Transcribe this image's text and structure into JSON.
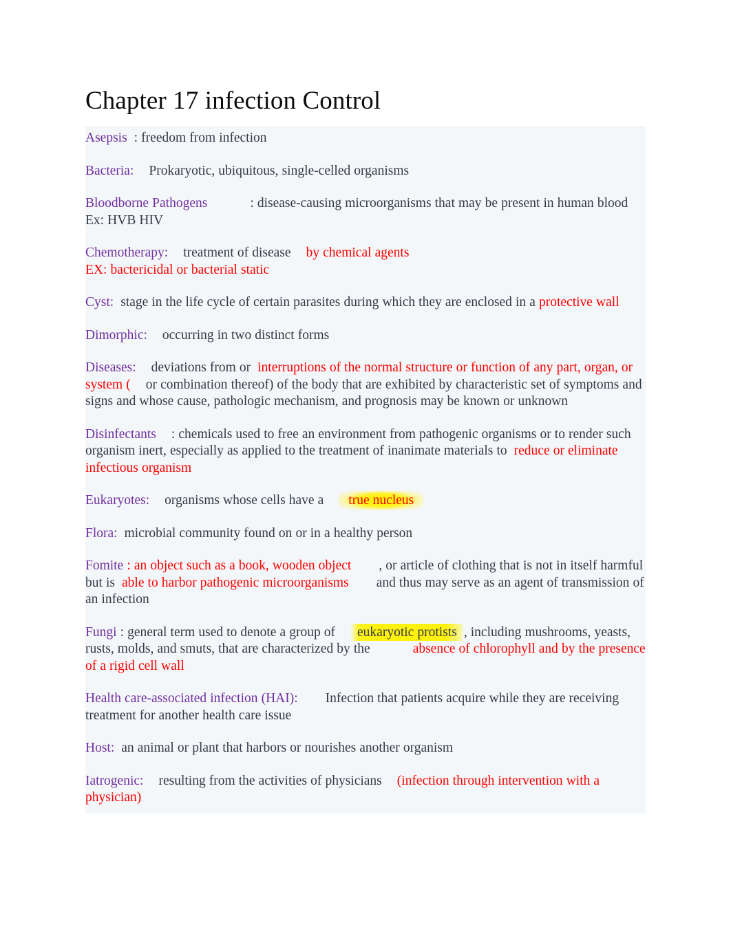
{
  "document": {
    "title": "Chapter 17 infection Control",
    "colors": {
      "term": "#7030A0",
      "accent_red": "#FF0000",
      "body_text": "#333A45",
      "highlight_yellow": "#FFF200",
      "content_background": "#F4F7F9",
      "page_background": "#FFFFFF"
    }
  },
  "entries": {
    "asepsis": {
      "term": "Asepsis",
      "sep": ": ",
      "definition": "freedom from infection"
    },
    "bacteria": {
      "term": "Bacteria:",
      "definition": "Prokaryotic, ubiquitous, single-celled organisms"
    },
    "bloodborne": {
      "term": "Bloodborne Pathogens",
      "sep": ":  ",
      "definition": "disease-causing microorganisms that may be present in human blood",
      "example": "Ex: HVB HIV"
    },
    "chemotherapy": {
      "term": "Chemotherapy:",
      "definition": "treatment of disease",
      "red_part": "by chemical agents",
      "example_red": "EX: bactericidal or bacterial static"
    },
    "cyst": {
      "term": "Cyst:",
      "definition": "stage in the life cycle of certain parasites during which they are enclosed in a",
      "red_part": "protective wall"
    },
    "dimorphic": {
      "term": "Dimorphic:",
      "definition": "occurring in two distinct forms"
    },
    "diseases": {
      "term": "Diseases:",
      "definition_a": "deviations from or",
      "red_part_a": "interruptions of the normal structure or function of any part, organ, or system (",
      "definition_b": "or combination thereof) of the body that are exhibited by characteristic set of symptoms and signs and whose cause, pathologic mechanism, and prognosis may be known or unknown"
    },
    "disinfectants": {
      "term": "Disinfectants",
      "sep": ": ",
      "definition": "chemicals used to free an environment from pathogenic organisms or to render such organism inert, especially as applied to the treatment of inanimate materials to",
      "red_part": "reduce or eliminate infectious organism"
    },
    "eukaryotes": {
      "term": "Eukaryotes:",
      "definition": "organisms whose cells have a",
      "highlighted_red": "true nucleus"
    },
    "flora": {
      "term": "Flora:",
      "definition": "microbial community found on or in a healthy person"
    },
    "fomite": {
      "term": "Fomite",
      "sep": " : ",
      "red_part_a": "an object such as a book, wooden object",
      "definition_a": ", or article of clothing that is not in itself harmful but is",
      "red_part_b": "able to harbor pathogenic microorganisms",
      "definition_b": "and thus may serve as an agent of transmission of an infection"
    },
    "fungi": {
      "term": "Fungi",
      "sep": " : ",
      "definition_a": "general term used to denote a group of",
      "highlighted": "eukaryotic protists",
      "definition_b": ", including mushrooms, yeasts, rusts, molds, and smuts, that are characterized by the",
      "red_part": "absence of chlorophyll and by the presence of a rigid cell wall"
    },
    "hai": {
      "term": "Health care-associated infection (HAI):",
      "definition": "Infection that patients acquire while they are receiving treatment for another health care issue"
    },
    "host": {
      "term": "Host:",
      "definition": "an animal or plant that harbors or nourishes another organism"
    },
    "iatrogenic": {
      "term": "Iatrogenic:",
      "definition": "resulting from the activities of physicians",
      "red_part": "(infection through intervention with a physician)"
    }
  }
}
